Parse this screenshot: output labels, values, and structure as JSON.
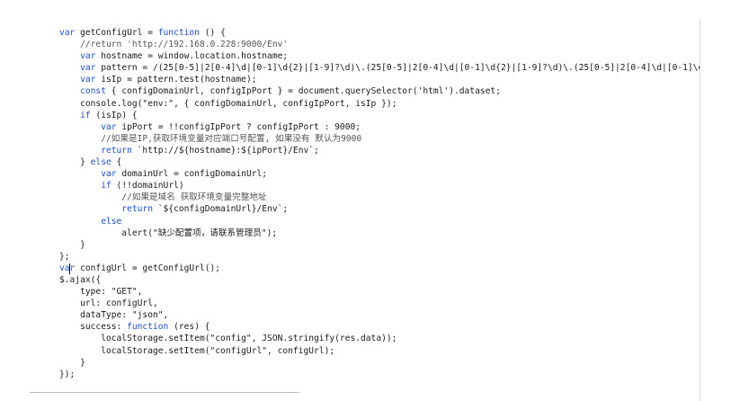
{
  "editor": {
    "lines": [
      "var getConfigUrl = function () {",
      "    //return 'http://192.168.0.228:9000/Env'",
      "    var hostname = window.location.hostname;",
      "    var pattern = /(25[0-5]|2[0-4]\\d|[0-1]\\d{2}|[1-9]?\\d)\\.(25[0-5]|2[0-4]\\d|[0-1]\\d{2}|[1-9]?\\d)\\.(25[0-5]|2[0-4]\\d|[0-1]\\d{2}|[",
      "    var isIp = pattern.test(hostname);",
      "    const { configDomainUrl, configIpPort } = document.querySelector('html').dataset;",
      "    console.log(\"env:\", { configDomainUrl, configIpPort, isIp });",
      "    if (isIp) {",
      "        var ipPort = !!configIpPort ? configIpPort : 9000;",
      "        //如果是IP,获取环境变量对应端口号配置, 如果没有 默认为9000",
      "        return `http://${hostname}:${ipPort}/Env`;",
      "    } else {",
      "        var domainUrl = configDomainUrl;",
      "        if (!!domainUrl)",
      "            //如果是域名 获取环境变量完整地址",
      "            return `${configDomainUrl}/Env`;",
      "        else",
      "            alert(\"缺少配置项，请联系管理员\");",
      "    }",
      "};",
      "var configUrl = getConfigUrl();",
      "$.ajax({",
      "    type: \"GET\",",
      "    url: configUrl,",
      "    dataType: \"json\",",
      "    success: function (res) {",
      "        localStorage.setItem(\"config\", JSON.stringify(res.data));",
      "        localStorage.setItem(\"configUrl\", configUrl);",
      "    }",
      "});"
    ]
  },
  "colors": {
    "keyword": "#1c4fd6",
    "text": "#1a1a1a",
    "string": "#1a1a1a",
    "comment": "#555555"
  }
}
